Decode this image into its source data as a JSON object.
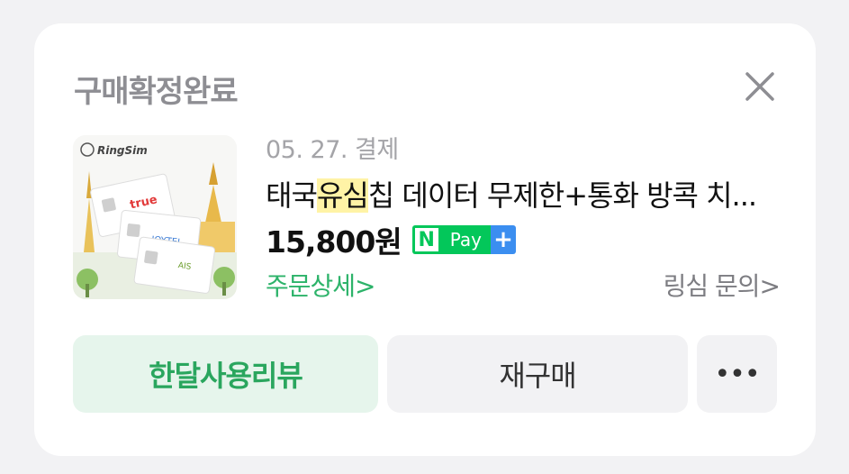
{
  "card": {
    "status_title": "구매확정완료",
    "close_icon": "close-icon"
  },
  "product": {
    "brand_logo_text": "RingSim",
    "sim_labels": [
      "true",
      "JOYTEL",
      "AIS"
    ],
    "order_date": "05. 27. 결제",
    "name_prefix": "태국",
    "name_highlight": "유심",
    "name_suffix": "칩 데이터 무제한+통화 방콕 치...",
    "price": "15,800원",
    "npay": {
      "n": "N",
      "pay": "Pay",
      "plus": "+"
    },
    "order_detail_label": "주문상세>",
    "inquiry_label": "링심 문의>"
  },
  "actions": {
    "review_label": "한달사용리뷰",
    "rebuy_label": "재구매",
    "more_label": "•••"
  },
  "colors": {
    "accent_green": "#2db36a",
    "npay_green": "#03c75a",
    "npay_blue": "#3b8ef0",
    "highlight": "#fff3a6"
  }
}
